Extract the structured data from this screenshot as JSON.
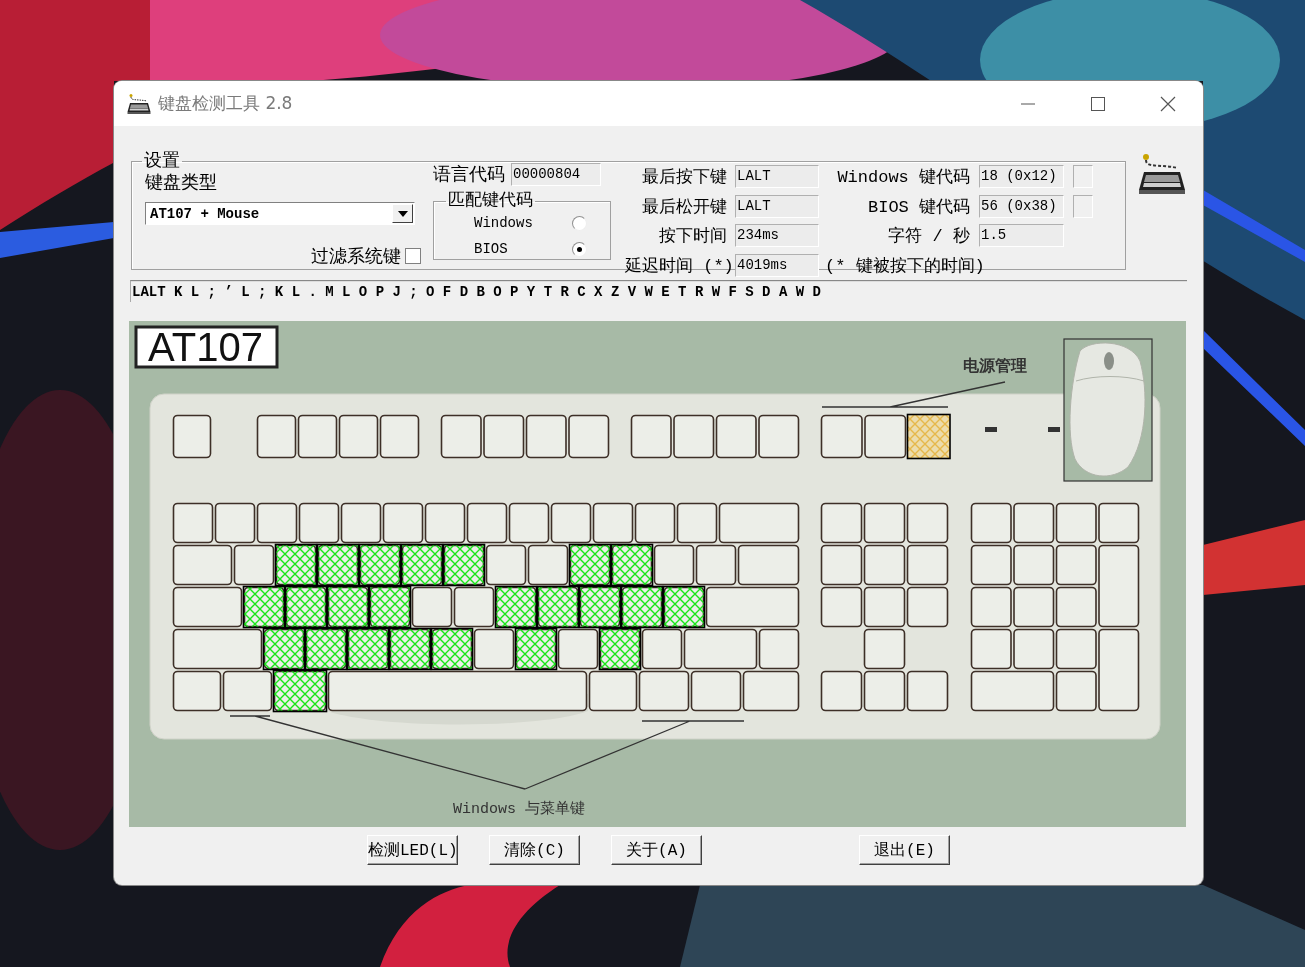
{
  "window": {
    "title": "键盘检测工具 2.8"
  },
  "settings": {
    "legend": "设置",
    "keyboard_type_label": "键盘类型",
    "keyboard_type": "AT107 + Mouse",
    "filter_label": "过滤系统键",
    "filter_checked": false,
    "language_label": "语言代码",
    "language_code": "00000804",
    "match_group": {
      "legend": "匹配键代码",
      "options": [
        {
          "label": "Windows",
          "selected": false
        },
        {
          "label": "BIOS",
          "selected": true
        }
      ]
    },
    "fields": [
      {
        "label": "最后按下键",
        "value": "LALT"
      },
      {
        "label": "最后松开键",
        "value": "LALT"
      },
      {
        "label": "按下时间",
        "value": "234ms"
      },
      {
        "label": "延迟时间 (*)",
        "value": "4019ms"
      }
    ],
    "codes": [
      {
        "label": "Windows 键代码",
        "value": "18 (0x12)",
        "indicator": true
      },
      {
        "label": "BIOS 键代码",
        "value": "56 (0x38)",
        "indicator": true
      },
      {
        "label": "字符 / 秒",
        "value": "1.5",
        "indicator": false
      }
    ],
    "note": "(* 键被按下的时间)"
  },
  "key_log": "LALT K L ; ’ L ; K L . M L O P J ; O F D B O P Y T R C X Z V W E T R W F S D A W D",
  "keyboard": {
    "model": "AT107",
    "power_label": "电源管理",
    "windows_label": "Windows 与菜单键",
    "keys": [
      {
        "tested": false,
        "highlighted": false
      },
      {
        "tested": false,
        "highlighted": false
      },
      {
        "tested": false,
        "highlighted": false
      },
      {
        "tested": false,
        "highlighted": false
      },
      {
        "tested": false,
        "highlighted": false
      },
      {
        "tested": false,
        "highlighted": false
      },
      {
        "tested": false,
        "highlighted": false
      },
      {
        "tested": false,
        "highlighted": false
      },
      {
        "tested": false,
        "highlighted": false
      },
      {
        "tested": false,
        "highlighted": false
      },
      {
        "tested": false,
        "highlighted": false
      },
      {
        "tested": false,
        "highlighted": false
      },
      {
        "tested": false,
        "highlighted": false
      },
      {
        "tested": false,
        "highlighted": false
      },
      {
        "tested": false,
        "highlighted": false
      },
      {
        "tested": false,
        "highlighted": true
      },
      {
        "tested": false,
        "highlighted": false
      },
      {
        "tested": false,
        "highlighted": false
      },
      {
        "tested": false,
        "highlighted": false
      },
      {
        "tested": false,
        "highlighted": false
      },
      {
        "tested": false,
        "highlighted": false
      },
      {
        "tested": false,
        "highlighted": false
      },
      {
        "tested": false,
        "highlighted": false
      },
      {
        "tested": false,
        "highlighted": false
      },
      {
        "tested": false,
        "highlighted": false
      },
      {
        "tested": false,
        "highlighted": false
      },
      {
        "tested": false,
        "highlighted": false
      },
      {
        "tested": false,
        "highlighted": false
      },
      {
        "tested": false,
        "highlighted": false
      },
      {
        "tested": false,
        "highlighted": false
      },
      {
        "tested": false,
        "highlighted": false
      },
      {
        "tested": false,
        "highlighted": false
      },
      {
        "tested": true,
        "highlighted": false
      },
      {
        "tested": true,
        "highlighted": false
      },
      {
        "tested": true,
        "highlighted": false
      },
      {
        "tested": true,
        "highlighted": false
      },
      {
        "tested": true,
        "highlighted": false
      },
      {
        "tested": false,
        "highlighted": false
      },
      {
        "tested": false,
        "highlighted": false
      },
      {
        "tested": true,
        "highlighted": false
      },
      {
        "tested": true,
        "highlighted": false
      },
      {
        "tested": false,
        "highlighted": false
      },
      {
        "tested": false,
        "highlighted": false
      },
      {
        "tested": false,
        "highlighted": false
      },
      {
        "tested": false,
        "highlighted": false
      },
      {
        "tested": true,
        "highlighted": false
      },
      {
        "tested": true,
        "highlighted": false
      },
      {
        "tested": true,
        "highlighted": false
      },
      {
        "tested": true,
        "highlighted": false
      },
      {
        "tested": false,
        "highlighted": false
      },
      {
        "tested": false,
        "highlighted": false
      },
      {
        "tested": true,
        "highlighted": false
      },
      {
        "tested": true,
        "highlighted": false
      },
      {
        "tested": true,
        "highlighted": false
      },
      {
        "tested": true,
        "highlighted": false
      },
      {
        "tested": true,
        "highlighted": false
      },
      {
        "tested": false,
        "highlighted": false
      },
      {
        "tested": false,
        "highlighted": false
      },
      {
        "tested": true,
        "highlighted": false
      },
      {
        "tested": true,
        "highlighted": false
      },
      {
        "tested": true,
        "highlighted": false
      },
      {
        "tested": true,
        "highlighted": false
      },
      {
        "tested": true,
        "highlighted": false
      },
      {
        "tested": false,
        "highlighted": false
      },
      {
        "tested": true,
        "highlighted": false
      },
      {
        "tested": false,
        "highlighted": false
      },
      {
        "tested": true,
        "highlighted": false
      },
      {
        "tested": false,
        "highlighted": false
      },
      {
        "tested": false,
        "highlighted": false
      },
      {
        "tested": false,
        "highlighted": false
      },
      {
        "tested": false,
        "highlighted": false
      },
      {
        "tested": false,
        "highlighted": false
      },
      {
        "tested": true,
        "highlighted": false
      },
      {
        "tested": false,
        "highlighted": false
      },
      {
        "tested": false,
        "highlighted": false
      },
      {
        "tested": false,
        "highlighted": false
      },
      {
        "tested": false,
        "highlighted": false
      },
      {
        "tested": false,
        "highlighted": false
      },
      {
        "tested": false,
        "highlighted": false
      },
      {
        "tested": false,
        "highlighted": false
      },
      {
        "tested": false,
        "highlighted": false
      },
      {
        "tested": false,
        "highlighted": false
      },
      {
        "tested": false,
        "highlighted": false
      },
      {
        "tested": false,
        "highlighted": false
      },
      {
        "tested": false,
        "highlighted": false
      },
      {
        "tested": false,
        "highlighted": false
      },
      {
        "tested": false,
        "highlighted": false
      },
      {
        "tested": false,
        "highlighted": false
      },
      {
        "tested": false,
        "highlighted": false
      },
      {
        "tested": false,
        "highlighted": false
      },
      {
        "tested": false,
        "highlighted": false
      },
      {
        "tested": false,
        "highlighted": false
      },
      {
        "tested": false,
        "highlighted": false
      },
      {
        "tested": false,
        "highlighted": false
      },
      {
        "tested": false,
        "highlighted": false
      },
      {
        "tested": false,
        "highlighted": false
      },
      {
        "tested": false,
        "highlighted": false
      },
      {
        "tested": false,
        "highlighted": false
      },
      {
        "tested": false,
        "highlighted": false
      },
      {
        "tested": false,
        "highlighted": false
      },
      {
        "tested": false,
        "highlighted": false
      },
      {
        "tested": false,
        "highlighted": false
      },
      {
        "tested": false,
        "highlighted": false
      },
      {
        "tested": false,
        "highlighted": false
      },
      {
        "tested": false,
        "highlighted": false
      },
      {
        "tested": false,
        "highlighted": false
      },
      {
        "tested": false,
        "highlighted": false
      },
      {
        "tested": false,
        "highlighted": false
      }
    ]
  },
  "buttons": [
    "检测LED(L)",
    "清除(C)",
    "关于(A)",
    "退出(E)"
  ]
}
